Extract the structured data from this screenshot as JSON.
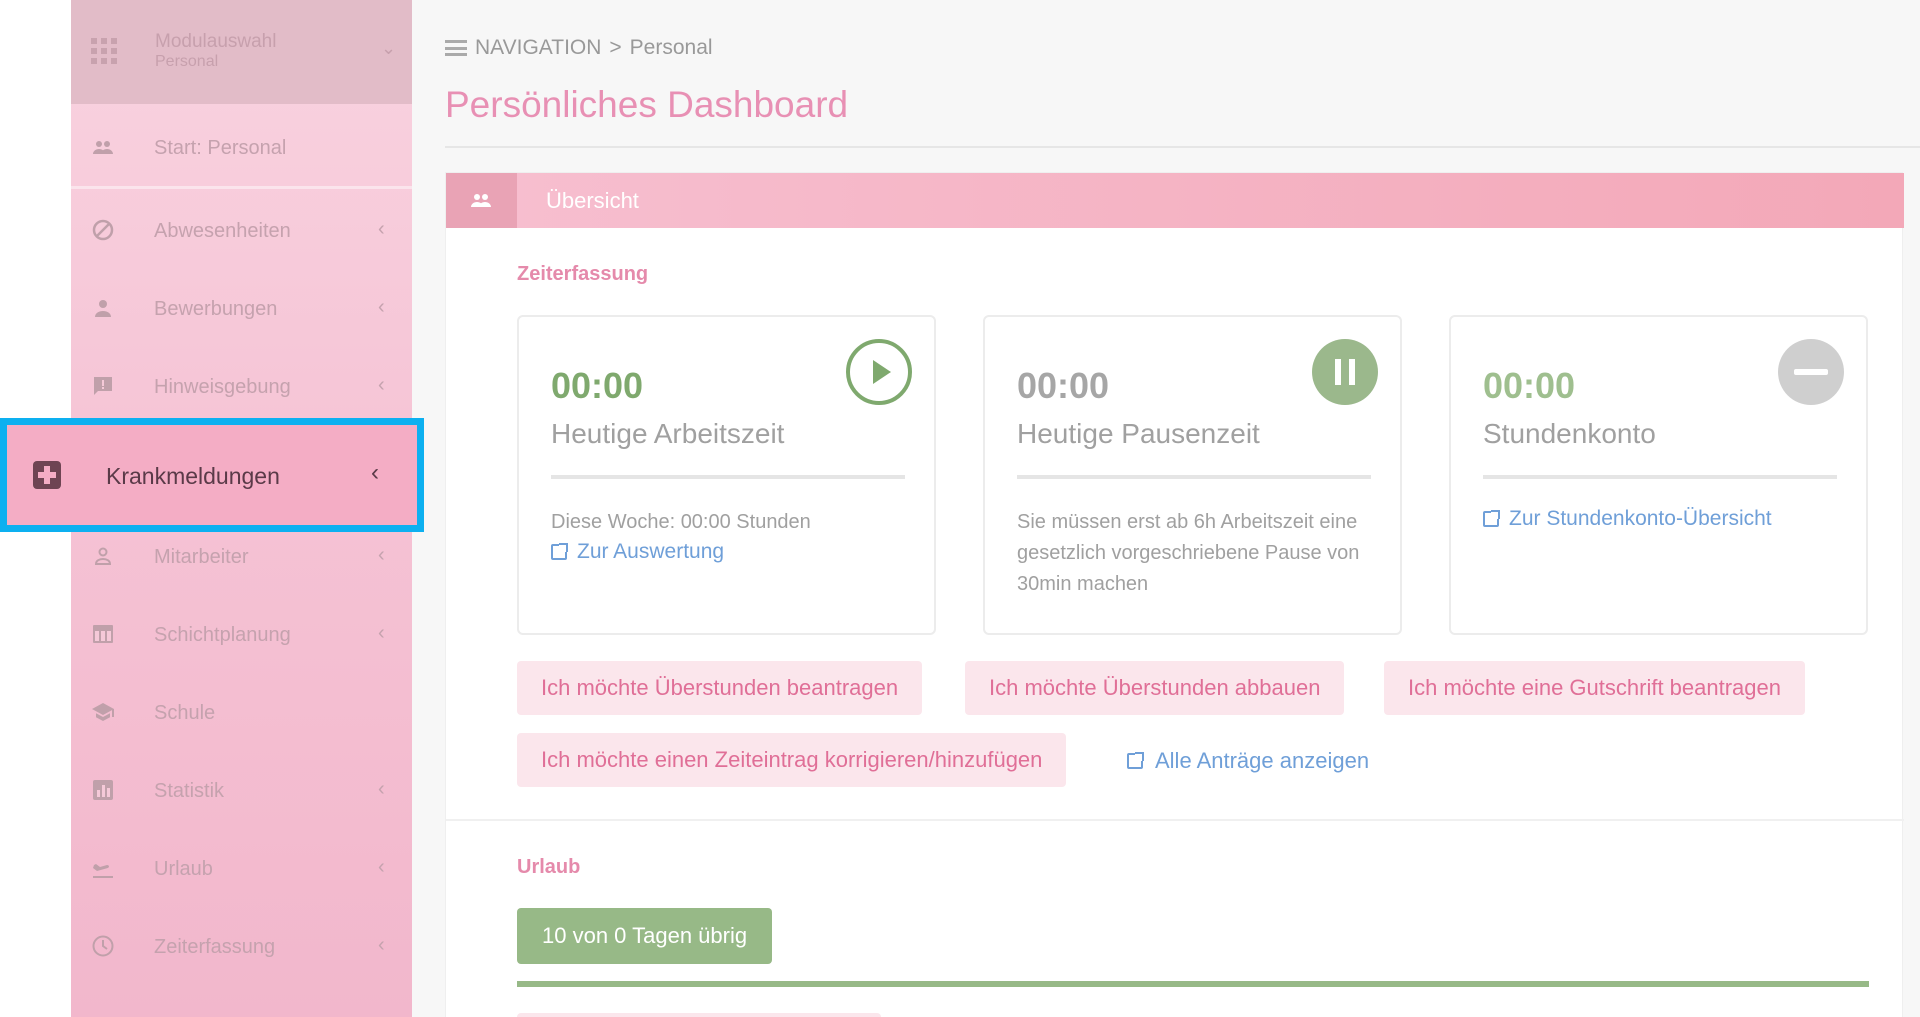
{
  "sidebar": {
    "module": {
      "label": "Modulauswahl",
      "sublabel": "Personal"
    },
    "items": [
      {
        "label": "Start: Personal",
        "icon": "group-icon",
        "arrow": ""
      },
      {
        "label": "Abwesenheiten",
        "icon": "block-icon",
        "arrow": "‹"
      },
      {
        "label": "Bewerbungen",
        "icon": "person-icon",
        "arrow": "‹"
      },
      {
        "label": "Hinweisgebung",
        "icon": "feedback-icon",
        "arrow": "‹"
      },
      {
        "label": "Krankmeldungen",
        "icon": "medical-cross-icon",
        "arrow": "‹"
      },
      {
        "label": "Mitarbeiter",
        "icon": "person-outline-icon",
        "arrow": "‹"
      },
      {
        "label": "Schichtplanung",
        "icon": "calendar-icon",
        "arrow": "‹"
      },
      {
        "label": "Schule",
        "icon": "school-icon",
        "arrow": ""
      },
      {
        "label": "Statistik",
        "icon": "chart-icon",
        "arrow": "‹"
      },
      {
        "label": "Urlaub",
        "icon": "flight-icon",
        "arrow": "‹"
      },
      {
        "label": "Zeiterfassung",
        "icon": "clock-icon",
        "arrow": "‹"
      }
    ]
  },
  "breadcrumb": {
    "root": "NAVIGATION",
    "separator": ">",
    "current": "Personal"
  },
  "page_title": "Persönliches Dashboard",
  "card": {
    "header": "Übersicht",
    "zeit_section": "Zeiterfassung",
    "tiles": [
      {
        "value": "00:00",
        "caption": "Heutige Arbeitszeit",
        "text": "Diese Woche: 00:00 Stunden",
        "link": "Zur Auswertung",
        "color": "#7fa96e",
        "icon": "play-icon"
      },
      {
        "value": "00:00",
        "caption": "Heutige Pausenzeit",
        "text": "Sie müssen erst ab 6h Arbeitszeit eine gesetzlich vorgeschriebene Pause von 30min machen",
        "link": "",
        "color": "#9bb88c",
        "icon": "pause-icon"
      },
      {
        "value": "00:00",
        "caption": "Stundenkonto",
        "text": "",
        "link": "Zur Stundenkonto-Übersicht",
        "color": "#9fbf8f",
        "icon": "minus-icon"
      }
    ],
    "buttons": {
      "ueberstunden_beantragen": "Ich möchte Überstunden beantragen",
      "ueberstunden_abbauen": "Ich möchte Überstunden abbauen",
      "gutschrift": "Ich möchte eine Gutschrift beantragen",
      "zeiteintrag": "Ich möchte einen Zeiteintrag korrigieren/hinzufügen",
      "alle_antraege": "Alle Anträge anzeigen"
    },
    "urlaub_section": "Urlaub",
    "urlaub_badge": "10 von 0 Tagen übrig",
    "urlaub_progress": 1.0
  }
}
